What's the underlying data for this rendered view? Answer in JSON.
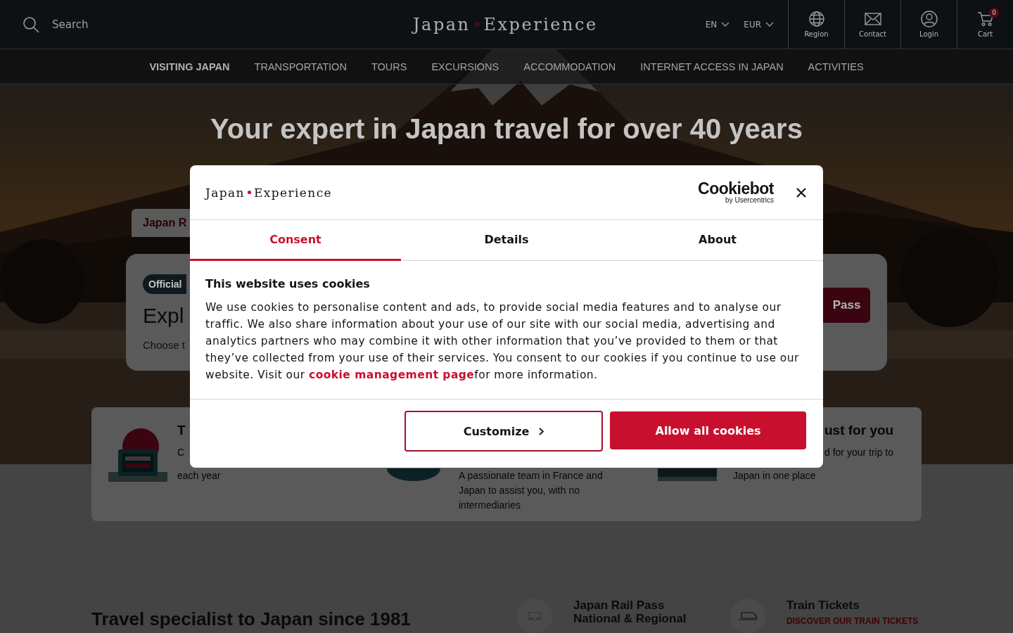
{
  "header": {
    "search": {
      "placeholder": "Search"
    },
    "logo": {
      "left": "Japan",
      "right": "Experience"
    },
    "language": "EN",
    "currency": "EUR",
    "actions": [
      {
        "kind": "globe",
        "label": "Region"
      },
      {
        "kind": "mail",
        "label": "Contact"
      },
      {
        "kind": "user",
        "label": "Login"
      },
      {
        "kind": "cart",
        "label": "Cart",
        "badge": "0"
      }
    ]
  },
  "nav": [
    {
      "label": "VISITING JAPAN",
      "selected": true
    },
    {
      "label": "TRANSPORTATION",
      "selected": false
    },
    {
      "label": "TOURS",
      "selected": false
    },
    {
      "label": "EXCURSIONS",
      "selected": false
    },
    {
      "label": "ACCOMMODATION",
      "selected": false
    },
    {
      "label": "INTERNET ACCESS IN JAPAN",
      "selected": false
    },
    {
      "label": "ACTIVITIES",
      "selected": false
    }
  ],
  "hero": {
    "title": "Your expert in Japan travel for over 40 years",
    "tab": "Japan R",
    "card": {
      "badge": "Official",
      "heading": "Expl",
      "text": "Choose t",
      "button": "Pass"
    }
  },
  "features": [
    {
      "kind": "suitcase",
      "title": "T",
      "lines": [
        "C",
        "each year"
      ]
    },
    {
      "kind": "team",
      "lines": [
        "A passionate team in France and",
        "Japan to assist you, with no",
        "intermediaries"
      ]
    },
    {
      "kind": "screen",
      "title": "ust for you",
      "lines": [
        "d for your trip to",
        "Japan in one place"
      ]
    }
  ],
  "intro": {
    "heading": "Travel specialist to Japan since 1981",
    "products": [
      {
        "kind": "pass",
        "lines": [
          "Japan Rail Pass",
          "National & Regional"
        ]
      },
      {
        "kind": "train",
        "lines": [
          "Train Tickets"
        ],
        "link": "DISCOVER OUR TRAIN TICKETS"
      }
    ]
  },
  "dialog": {
    "logo": {
      "left": "Japan",
      "right": "Experience"
    },
    "brand": "Cookiebot",
    "brand_sub": "by Usercentrics",
    "tabs": [
      {
        "label": "Consent",
        "selected": true
      },
      {
        "label": "Details",
        "selected": false
      },
      {
        "label": "About",
        "selected": false
      }
    ],
    "title": "This website uses cookies",
    "text_before": "We use cookies to personalise content and ads, to provide social media features and to analyse our traffic. We also share information about your use of our site with our social media, advertising and analytics partners who may combine it with other information that you’ve provided to them or that they’ve collected from your use of their services. You consent to our cookies if you continue to use our website. Visit our ",
    "link": "cookie management page",
    "text_after": "for more information.",
    "buttons": [
      {
        "kind": "outline",
        "label": "Customize"
      },
      {
        "kind": "primary",
        "label": "Allow all cookies"
      }
    ]
  }
}
